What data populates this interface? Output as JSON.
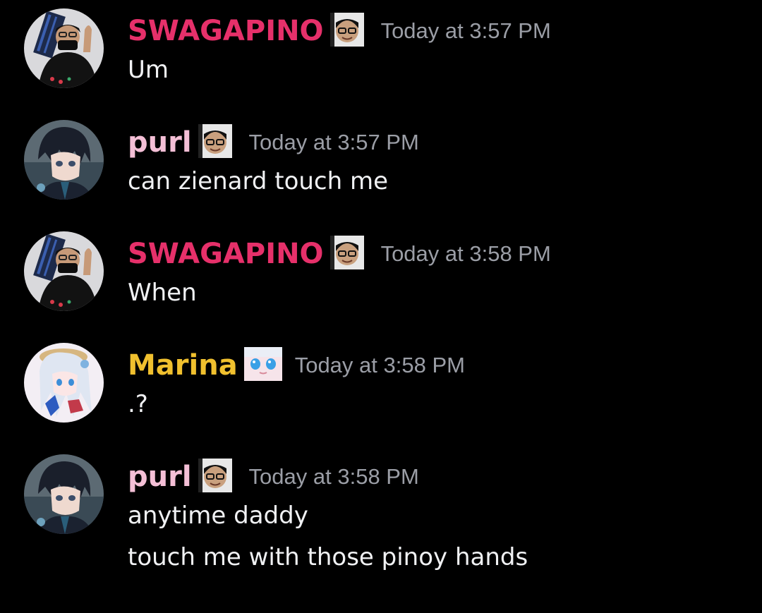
{
  "colors": {
    "background": "#000000",
    "timestamp": "#9b9ea6",
    "text": "#f0f1f3",
    "swagapino": "#e6306a",
    "purl": "#f4bfd6",
    "marina": "#f0c02e"
  },
  "messages": [
    {
      "author": "SWAGAPINO",
      "author_color": "#e6306a",
      "badge_icon": "face-with-glasses-badge",
      "avatar_icon": "swagapino-avatar",
      "timestamp": "Today at 3:57 PM",
      "lines": [
        "Um"
      ]
    },
    {
      "author": "purl",
      "author_color": "#f4bfd6",
      "badge_icon": "face-with-glasses-badge",
      "avatar_icon": "anime-boy-avatar",
      "timestamp": "Today at 3:57 PM",
      "lines": [
        "can zienard touch me"
      ]
    },
    {
      "author": "SWAGAPINO",
      "author_color": "#e6306a",
      "badge_icon": "face-with-glasses-badge",
      "avatar_icon": "swagapino-avatar",
      "timestamp": "Today at 3:58 PM",
      "lines": [
        "When"
      ]
    },
    {
      "author": "Marina",
      "author_color": "#f0c02e",
      "badge_icon": "anime-eyes-badge",
      "avatar_icon": "anime-girl-avatar",
      "timestamp": "Today at 3:58 PM",
      "lines": [
        ".?"
      ]
    },
    {
      "author": "purl",
      "author_color": "#f4bfd6",
      "badge_icon": "face-with-glasses-badge",
      "avatar_icon": "anime-boy-avatar",
      "timestamp": "Today at 3:58 PM",
      "lines": [
        "anytime daddy",
        "touch me with those pinoy hands"
      ]
    }
  ]
}
